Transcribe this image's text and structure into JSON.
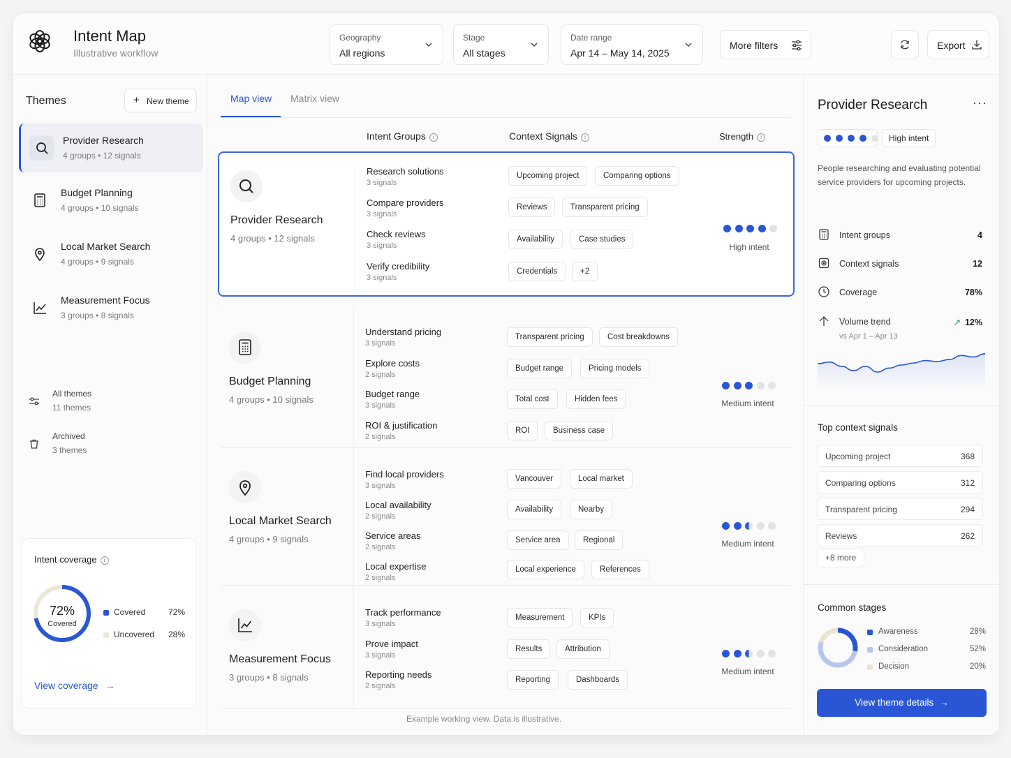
{
  "header": {
    "title": "Intent Map",
    "subtitle": "Illustrative workflow",
    "filters": [
      {
        "label": "Geography",
        "value": "All regions"
      },
      {
        "label": "Stage",
        "value": "All stages"
      },
      {
        "label": "Date range",
        "value": "Apr 14 – May 14, 2025"
      }
    ],
    "more_filters": "More filters",
    "export": "Export"
  },
  "sidebar": {
    "title": "Themes",
    "new_theme": "New theme",
    "items": [
      {
        "name": "Provider Research",
        "meta": "4 groups  •  12 signals",
        "icon": "search-icon"
      },
      {
        "name": "Budget Planning",
        "meta": "4 groups  •  10 signals",
        "icon": "calculator-icon"
      },
      {
        "name": "Local Market Search",
        "meta": "4 groups  •  9 signals",
        "icon": "location-pin-icon"
      },
      {
        "name": "Measurement Focus",
        "meta": "3 groups  •  8 signals",
        "icon": "chart-line-icon"
      }
    ],
    "links": [
      {
        "title": "All themes",
        "sub": "11 themes"
      },
      {
        "title": "Archived",
        "sub": "3 themes"
      }
    ],
    "coverage": {
      "title": "Intent coverage",
      "value": "72%",
      "value_label": "Covered",
      "covered_fraction": 0.72,
      "legend": [
        {
          "label": "Covered",
          "pct": "72%",
          "color": "#2a56d6"
        },
        {
          "label": "Uncovered",
          "pct": "28%",
          "color": "#ece6d4"
        }
      ],
      "link": "View coverage"
    }
  },
  "main": {
    "tabs": [
      "Map view",
      "Matrix view"
    ],
    "columns": {
      "groups": "Intent Groups",
      "signals": "Context Signals",
      "strength": "Strength"
    },
    "rows": [
      {
        "name": "Provider Research",
        "meta": "4 groups  •  12 signals",
        "strength": 4,
        "intent": "High intent",
        "groups": [
          {
            "name": "Research solutions",
            "signals": "3 signals"
          },
          {
            "name": "Compare providers",
            "signals": "3 signals"
          },
          {
            "name": "Check reviews",
            "signals": "3 signals"
          },
          {
            "name": "Verify credibility",
            "signals": "3 signals"
          }
        ],
        "chips": [
          [
            "Upcoming project",
            "Comparing options"
          ],
          [
            "Reviews",
            "Transparent pricing"
          ],
          [
            "Availability",
            "Case studies"
          ],
          [
            "Credentials",
            "+2"
          ]
        ]
      },
      {
        "name": "Budget Planning",
        "meta": "4 groups  •  10 signals",
        "strength": 3,
        "intent": "Medium intent",
        "groups": [
          {
            "name": "Understand pricing",
            "signals": "3 signals"
          },
          {
            "name": "Explore costs",
            "signals": "2 signals"
          },
          {
            "name": "Budget range",
            "signals": "3 signals"
          },
          {
            "name": "ROI & justification",
            "signals": "2 signals"
          }
        ],
        "chips": [
          [
            "Transparent pricing",
            "Cost breakdowns"
          ],
          [
            "Budget range",
            "Pricing models"
          ],
          [
            "Total cost",
            "Hidden fees"
          ],
          [
            "ROI",
            "Business case"
          ]
        ]
      },
      {
        "name": "Local Market Search",
        "meta": "4 groups  •  9 signals",
        "strength": 2.5,
        "intent": "Medium intent",
        "groups": [
          {
            "name": "Find local providers",
            "signals": "3 signals"
          },
          {
            "name": "Local availability",
            "signals": "2 signals"
          },
          {
            "name": "Service areas",
            "signals": "2 signals"
          },
          {
            "name": "Local expertise",
            "signals": "2 signals"
          }
        ],
        "chips": [
          [
            "Vancouver",
            "Local market"
          ],
          [
            "Availability",
            "Nearby"
          ],
          [
            "Service area",
            "Regional"
          ],
          [
            "Local experience",
            "References"
          ]
        ]
      },
      {
        "name": "Measurement Focus",
        "meta": "3 groups  •  8 signals",
        "strength": 2.5,
        "intent": "Medium intent",
        "groups": [
          {
            "name": "Track performance",
            "signals": "3 signals"
          },
          {
            "name": "Prove impact",
            "signals": "3 signals"
          },
          {
            "name": "Reporting needs",
            "signals": "2 signals"
          }
        ],
        "chips": [
          [
            "Measurement",
            "KPIs"
          ],
          [
            "Results",
            "Attribution"
          ],
          [
            "Reporting",
            "Dashboards"
          ]
        ]
      }
    ],
    "footer": "Example working view. Data is illustrative."
  },
  "panel": {
    "title": "Provider Research",
    "strength": 4,
    "intent": "High intent",
    "description": "People researching and evaluating potential service providers for upcoming projects.",
    "stats": [
      {
        "label": "Intent groups",
        "value": "4"
      },
      {
        "label": "Context signals",
        "value": "12"
      },
      {
        "label": "Coverage",
        "value": "78%"
      },
      {
        "label": "Volume trend",
        "value": "12%"
      }
    ],
    "trend_sub": "vs Apr 1 – Apr 13",
    "sparkline": [
      0.45,
      0.38,
      0.55,
      0.72,
      0.55,
      0.78,
      0.62,
      0.5,
      0.42,
      0.32,
      0.36,
      0.28,
      0.12,
      0.18,
      0.05
    ],
    "top_signals_title": "Top context signals",
    "top_signals": [
      {
        "name": "Upcoming project",
        "count": "368"
      },
      {
        "name": "Comparing options",
        "count": "312"
      },
      {
        "name": "Transparent pricing",
        "count": "294"
      },
      {
        "name": "Reviews",
        "count": "262"
      }
    ],
    "more_signals": "+8 more",
    "stages_title": "Common stages",
    "stages": [
      {
        "label": "Awareness",
        "pct": "28%",
        "value": 28,
        "color": "#2a56d6"
      },
      {
        "label": "Consideration",
        "pct": "52%",
        "value": 52,
        "color": "#b9c6ec"
      },
      {
        "label": "Decision",
        "pct": "20%",
        "value": 20,
        "color": "#ece4cf"
      }
    ],
    "cta": "View theme details"
  }
}
